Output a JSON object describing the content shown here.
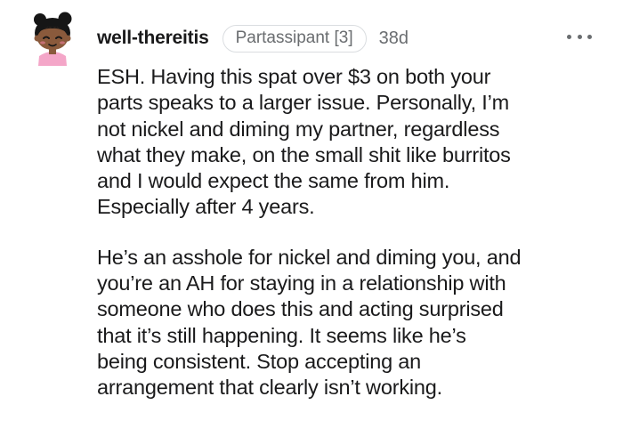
{
  "comment": {
    "author": "well-thereitis",
    "flair": "Partassipant [3]",
    "age": "38d",
    "paragraphs": [
      [
        "ESH. Having this spat over $3 on both your",
        "parts speaks to a larger issue. Personally, I’m",
        "not nickel and diming my partner, regardless",
        "what they make, on the small shit like burritos",
        "and I would expect the same from him.",
        "Especially after 4 years."
      ],
      [
        "He’s an asshole for nickel and diming you, and",
        "you’re an AH for staying in a relationship with",
        "someone who does this and acting surprised",
        "that it’s still happening. It seems like he’s",
        "being consistent. Stop accepting an",
        "arrangement that clearly isn’t working."
      ]
    ]
  },
  "icons": {
    "avatar": "snoo-avatar-icon",
    "more": "more-options-icon"
  },
  "colors": {
    "text": "#1a1a1b",
    "meta": "#6a6d70",
    "flair_border": "#dadde0",
    "avatar_skin": "#8a5a3c",
    "avatar_hair": "#161616",
    "avatar_shirt": "#f4a6c8"
  }
}
